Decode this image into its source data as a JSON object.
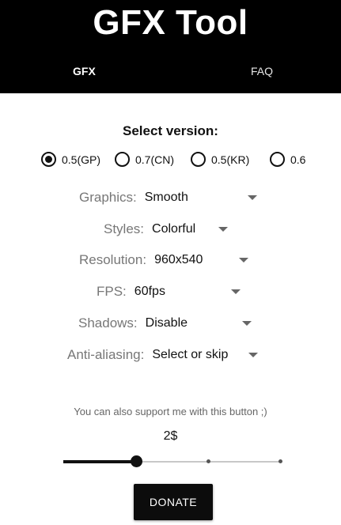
{
  "app": {
    "title": "GFX Tool"
  },
  "tabs": [
    {
      "label": "GFX"
    },
    {
      "label": "FAQ"
    }
  ],
  "version": {
    "heading": "Select version:",
    "options": [
      {
        "label": "0.5(GP)",
        "checked": true
      },
      {
        "label": "0.7(CN)",
        "checked": false
      },
      {
        "label": "0.5(KR)",
        "checked": false
      },
      {
        "label": "0.6",
        "checked": false
      }
    ]
  },
  "settings": {
    "graphics": {
      "label": "Graphics:",
      "value": "Smooth"
    },
    "styles": {
      "label": "Styles:",
      "value": "Colorful"
    },
    "resolution": {
      "label": "Resolution:",
      "value": "960x540"
    },
    "fps": {
      "label": "FPS:",
      "value": "60fps"
    },
    "shadows": {
      "label": "Shadows:",
      "value": "Disable"
    },
    "antialiasing": {
      "label": "Anti-aliasing:",
      "value": "Select or skip"
    }
  },
  "support": {
    "text": "You can also support me with this button ;)",
    "amount": "2$",
    "slider_value_fraction": 0.33,
    "button_label": "DONATE"
  },
  "colors": {
    "header_bg": "#000000",
    "accent": "#111111",
    "label_gray": "#777777"
  }
}
